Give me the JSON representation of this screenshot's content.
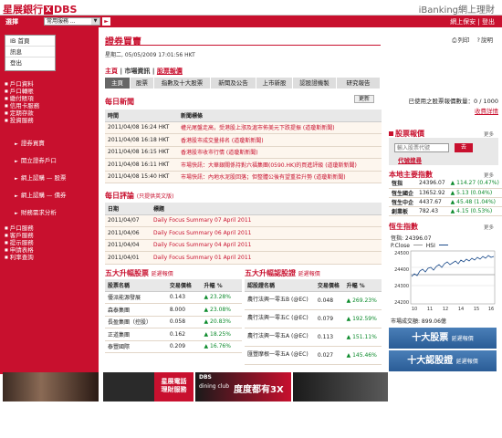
{
  "header": {
    "logo_text": "星展銀行",
    "logo_x": "X",
    "logo_brand": "DBS",
    "ibanking": "iBanking網上理財",
    "select_label": "選擇",
    "select_value": "常用服務 ...",
    "select_arrow": "▼",
    "go": "►",
    "top_right": "網上保安 | 登出"
  },
  "sidebar": {
    "box_items": [
      "IB 首頁",
      "訊息",
      "登出"
    ],
    "group1": [
      "戶口資料",
      "戶口轉賬",
      "繳付賬項",
      "信用卡服務",
      "定期存款",
      "投資服務"
    ],
    "sub_items": [
      "證券買賣",
      "開立證券戶口",
      "網上認購 — 股票",
      "網上認購 — 債券",
      "財務需求分析"
    ],
    "group2": [
      "戶口服務",
      "客戶服務",
      "提示服務",
      "申請表格",
      "利率查詢"
    ]
  },
  "main": {
    "title": "證券買賣",
    "user_line": "星期二, 05/05/2009 17:01:56  HKT",
    "print_label": "列印",
    "help_label": "說明",
    "crumb": [
      "主頁",
      "市場資訊",
      "股票報價"
    ],
    "crumb_sep": "|",
    "tabs": [
      "主頁",
      "股票",
      "指數及十大股票",
      "新聞及公告",
      "上市新股",
      "認股證機製",
      "研究報告"
    ]
  },
  "news": {
    "title": "每日新聞",
    "more": "更新",
    "headers": [
      "時間",
      "新聞標條"
    ],
    "rows": [
      [
        "2011/04/08 16:24 HKT",
        "權光尾盤走高，受港股上漲及滬市佈美元下跌提振 (道瓊斯新聞)"
      ],
      [
        "2011/04/08 16:18 HKT",
        "香港股市成交量排名 (道瓊斯新聞)"
      ],
      [
        "2011/04/08 16:15 HKT",
        "香港股市收市行情 (道瓊斯新聞)"
      ],
      [
        "2011/04/08 16:11 HKT",
        "市場快訊：大華銀關係持對六福集團(0590.HK)的買進評級 (道瓊斯新聞)"
      ],
      [
        "2011/04/08 15:40 HKT",
        "市場快訊：內地水泥股回落；但整體公後有望重拾升勢 (道瓊斯新聞)"
      ]
    ]
  },
  "commentary": {
    "title": "每日評論",
    "note": "(只提供英文版)",
    "headers": [
      "日期",
      "標題"
    ],
    "rows": [
      [
        "2011/04/07",
        "Daily Focus Summary 07 April 2011"
      ],
      [
        "2011/04/06",
        "Daily Focus Summary 06 April 2011"
      ],
      [
        "2011/04/04",
        "Daily Focus Summary 04 April 2011"
      ],
      [
        "2011/04/01",
        "Daily Focus Summary 01 April 2011"
      ]
    ]
  },
  "top_stocks": {
    "title": "五大升幅股票",
    "delay": "延遲報價",
    "headers": [
      "股票名稱",
      "交易價格",
      "升幅 %"
    ],
    "rows": [
      [
        "優派能源發展",
        "0.143",
        "▲ 23.28%"
      ],
      [
        "森泰集團",
        "8.000",
        "▲ 23.08%"
      ],
      [
        "長盈集團（控股）",
        "0.058",
        "▲ 20.83%"
      ],
      [
        "正道集團",
        "0.162",
        "▲ 18.25%"
      ],
      [
        "泰豐國際",
        "0.209",
        "▲ 16.76%"
      ]
    ]
  },
  "top_warrants": {
    "title": "五大升幅認股證",
    "delay": "延遲報價",
    "headers": [
      "認股證名稱",
      "交易價格",
      "升幅 %"
    ],
    "rows": [
      [
        "農行法興一零五B (@EC)",
        "0.048",
        "▲ 269.23%"
      ],
      [
        "農行法興一零五C (@EC)",
        "0.079",
        "▲ 192.59%"
      ],
      [
        "農行法興一零五A (@EC)",
        "0.113",
        "▲ 151.11%"
      ],
      [
        "匯豐摩根一零五A (@EC)",
        "0.027",
        "▲ 145.46%"
      ]
    ]
  },
  "right": {
    "shares_left": "已使用之股票報價數量：0 / 1000",
    "buy_link": "收費詳情",
    "quote_title": "股票報價",
    "more": "更多",
    "input_placeholder": "輸入股票代號",
    "go": "去",
    "code_link": "代號搜尋",
    "market_title": "本地主要指數",
    "indices": [
      [
        "恆指",
        "24396.07",
        "▲ 114.27 (0.47%)"
      ],
      [
        "恆生國企",
        "13652.92",
        "▲ 5.13 (0.04%)"
      ],
      [
        "恆生中企",
        "4437.67",
        "▲ 45.48 (1.04%)"
      ],
      [
        "創業板",
        "782.43",
        "▲ 4.15 (0.53%)"
      ]
    ],
    "hsi_title": "恆生指數",
    "hsi_line1": "恆指: 24396.07",
    "hsi_legend_pclose": "P.Close",
    "hsi_legend_hsi": "HSI",
    "hsi_yticks": [
      "24500",
      "24400",
      "24300",
      "24200"
    ],
    "hsi_xticks": [
      "10",
      "11",
      "12",
      "14",
      "15",
      "16"
    ],
    "turnover": "市場成交額: 899.06億",
    "banner1": "十大股票",
    "banner1_sub": "延遲報價",
    "banner2": "十大認股證",
    "banner2_sub": "延遲報價"
  },
  "ads": {
    "ad2_line1": "星展電話",
    "ad2_line2": "理財服務",
    "ad3_brand": "DBS",
    "ad3_text": "度度都有3X",
    "ad3_club": "dining club"
  }
}
